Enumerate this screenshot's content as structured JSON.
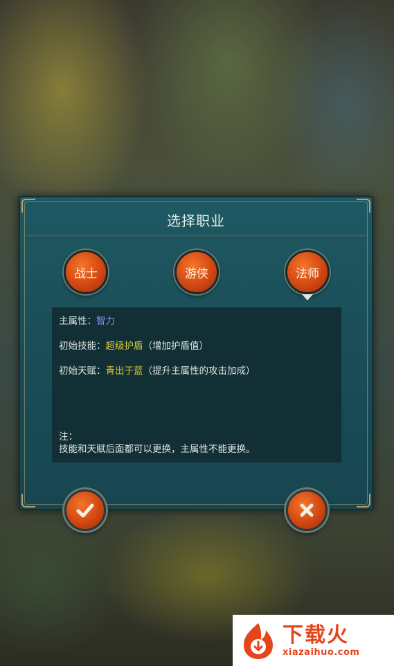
{
  "dialog": {
    "title": "选择职业",
    "classes": [
      {
        "label": "战士",
        "selected": false
      },
      {
        "label": "游侠",
        "selected": false
      },
      {
        "label": "法师",
        "selected": true
      }
    ],
    "info": {
      "attr_label": "主属性：",
      "attr_value": "智力",
      "skill_label": "初始技能：",
      "skill_value": "超级护盾",
      "skill_desc": "（增加护盾值）",
      "talent_label": "初始天赋：",
      "talent_value": "青出于蓝",
      "talent_desc": "（提升主属性的攻击加成）",
      "note_title": "注：",
      "note_text": "技能和天赋后面都可以更换，主属性不能更换。"
    },
    "actions": {
      "confirm_icon": "checkmark-icon",
      "cancel_icon": "close-icon"
    }
  },
  "watermark": {
    "name": "下载火",
    "url": "xiazaihuo.com"
  },
  "colors": {
    "panel": "#1a4d57",
    "button_orange": "#d24712",
    "attr_value": "#8f8cf0",
    "highlight_value": "#d6c83a"
  }
}
